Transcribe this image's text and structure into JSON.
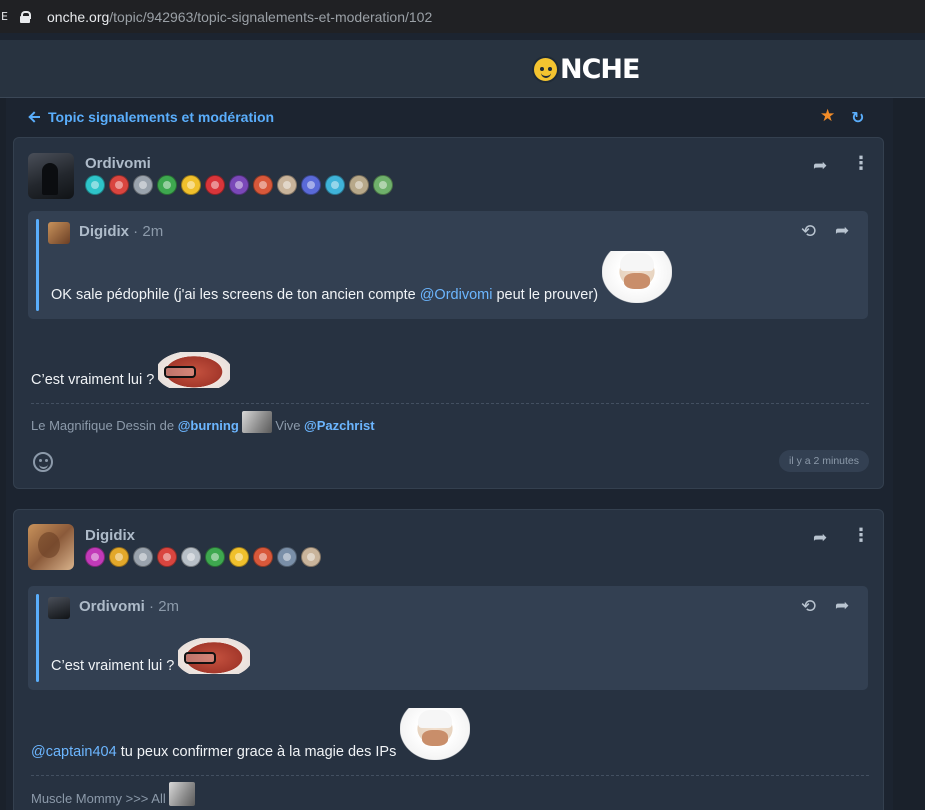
{
  "browser": {
    "edge_glyph": "E",
    "url_host": "onche.org",
    "url_path": "/topic/942963/topic-signalements-et-moderation/102"
  },
  "site": {
    "logo_text": "NCHE"
  },
  "topic": {
    "title": "Topic signalements et modération",
    "back_icon": "arrow-left-icon",
    "favorite_icon": "star-icon",
    "refresh_icon": "refresh-icon"
  },
  "icons": {
    "share": "➦",
    "more": "⋮",
    "history": "⟲",
    "star": "★",
    "refresh": "↻"
  },
  "posts": [
    {
      "author": "Ordivomi",
      "badges": [
        "#2ec4c9",
        "#d9453f",
        "#9aa3ad",
        "#3ea84f",
        "#f0c02c",
        "#d9353a",
        "#7a48b8",
        "#d8583a",
        "#c9b49b",
        "#5a6ad8",
        "#3fb3d9",
        "#b7a88a",
        "#6fb06b"
      ],
      "quote": {
        "author": "Digidix",
        "time": " · 2m",
        "text_before": "OK sale pédophile (j'ai les screens de ton ancien compte ",
        "mention": "@Ordivomi",
        "text_after": " peut le prouver) "
      },
      "body": "C’est vraiment lui ? ",
      "signature": {
        "prefix": "Le Magnifique Dessin de ",
        "mention1": "@burning",
        "middle": " Vive ",
        "mention2": "@Pazchrist"
      },
      "timestamp": "il y a 2 minutes"
    },
    {
      "author": "Digidix",
      "badges": [
        "#c23ab8",
        "#e3a82a",
        "#9aa3ad",
        "#d9453f",
        "#b8c0c8",
        "#3ea84f",
        "#f0c02c",
        "#d8583a",
        "#7a8fa8",
        "#c9b49b"
      ],
      "quote": {
        "author": "Ordivomi",
        "time": " · 2m",
        "text": "C’est vraiment lui ? "
      },
      "body_mention": "@captain404",
      "body": " tu peux confirmer grace à la magie des IPs ",
      "signature": "Muscle Mommy >>> All "
    }
  ]
}
